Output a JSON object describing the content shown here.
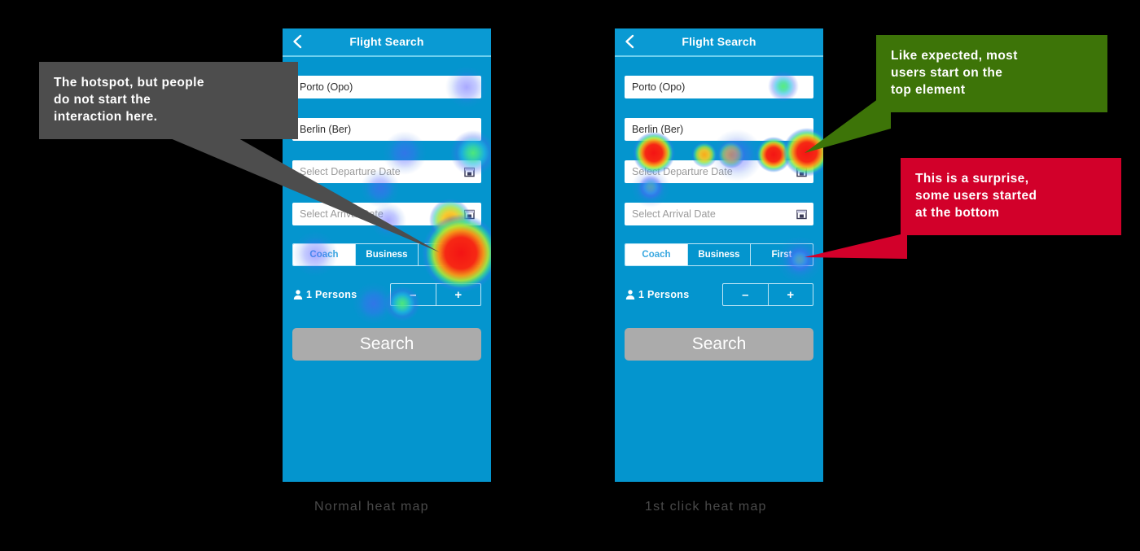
{
  "page": {
    "background": "#000000"
  },
  "phones": [
    {
      "id": "normal-heat-map",
      "caption": "Normal heat map",
      "header": {
        "title": "Flight Search",
        "back_icon": "chevron-left-icon"
      },
      "fields": {
        "origin_value": "Porto (Opo)",
        "destination_value": "Berlin (Ber)",
        "departure_placeholder": "Select Departure Date",
        "arrival_placeholder": "Select Arrival Date",
        "calendar_icon": "calendar-icon"
      },
      "class_segments": [
        {
          "label": "Coach",
          "selected": true
        },
        {
          "label": "Business",
          "selected": false
        },
        {
          "label": "First",
          "selected": false
        }
      ],
      "persons": {
        "icon": "person-icon",
        "label": "1  Persons",
        "decrement_label": "–",
        "increment_label": "+"
      },
      "search_label": "Search"
    },
    {
      "id": "first-click-heat-map",
      "caption": "1st click heat map",
      "header": {
        "title": "Flight Search",
        "back_icon": "chevron-left-icon"
      },
      "fields": {
        "origin_value": "Porto (Opo)",
        "destination_value": "Berlin (Ber)",
        "departure_placeholder": "Select Departure Date",
        "arrival_placeholder": "Select Arrival Date",
        "calendar_icon": "calendar-icon"
      },
      "class_segments": [
        {
          "label": "Coach",
          "selected": true
        },
        {
          "label": "Business",
          "selected": false
        },
        {
          "label": "First",
          "selected": false
        }
      ],
      "persons": {
        "icon": "person-icon",
        "label": "1  Persons",
        "decrement_label": "–",
        "increment_label": "+"
      },
      "search_label": "Search"
    }
  ],
  "callouts": [
    {
      "id": "gray-callout",
      "text": "The hotspot, but people\ndo not start the\ninteraction here.",
      "color": "#4d4d4d"
    },
    {
      "id": "green-callout",
      "text": "Like expected, most\nusers start on the\ntop element",
      "color": "#3d7408"
    },
    {
      "id": "red-callout",
      "text": "This is a surprise,\nsome users started\nat the bottom",
      "color": "#d2002a"
    }
  ],
  "heatmap_legend": {
    "cold": "#4a5aff",
    "mid": "#3cd8a0",
    "warm": "#faaa19",
    "hot": "#f41414"
  }
}
